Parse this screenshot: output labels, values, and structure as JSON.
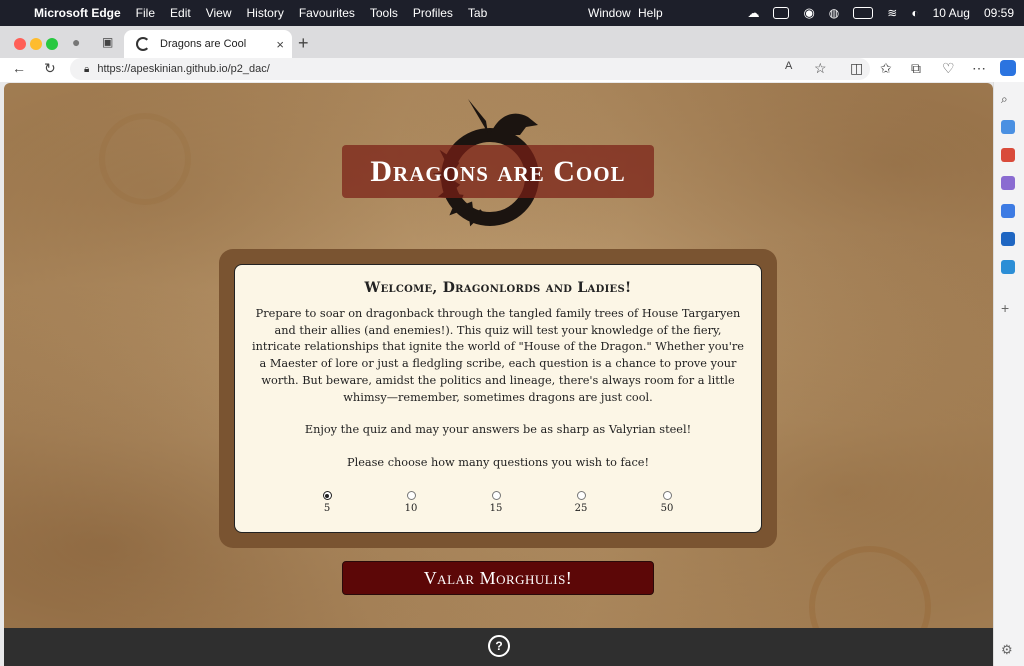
{
  "menubar": {
    "app": "Microsoft Edge",
    "items": [
      "File",
      "Edit",
      "View",
      "History",
      "Favourites",
      "Tools",
      "Profiles",
      "Tab"
    ],
    "right_items": [
      "Window",
      "Help"
    ],
    "date": "10 Aug",
    "time": "09:59"
  },
  "browser": {
    "tab_title": "Dragons are Cool",
    "tab_close": "×",
    "new_tab": "+",
    "url": "https://apeskinian.github.io/p2_dac/"
  },
  "page": {
    "title": "Dragons are Cool",
    "welcome_heading": "Welcome, Dragonlords and Ladies!",
    "intro": "Prepare to soar on dragonback through the tangled family trees of House Targaryen and their allies (and enemies!). This quiz will test your knowledge of the fiery, intricate relationships that ignite the world of \"House of the Dragon.\" Whether you're a Maester of lore or just a fledgling scribe, each question is a chance to prove your worth. But beware, amidst the politics and lineage, there's always room for a little whimsy—remember, sometimes dragons are just cool.",
    "enjoy": "Enjoy the quiz and may your answers be as sharp as Valyrian steel!",
    "choose": "Please choose how many questions you wish to face!",
    "question_options": [
      "5",
      "10",
      "15",
      "25",
      "50"
    ],
    "selected_option": "5",
    "start_button": "Valar Morghulis!",
    "help_icon": "?"
  },
  "colors": {
    "title_bg": "#7a2016",
    "button_bg": "#5c0707",
    "card_bg": "#fcf6e6",
    "frame": "#7a5431",
    "footer": "#2f2f2f"
  }
}
